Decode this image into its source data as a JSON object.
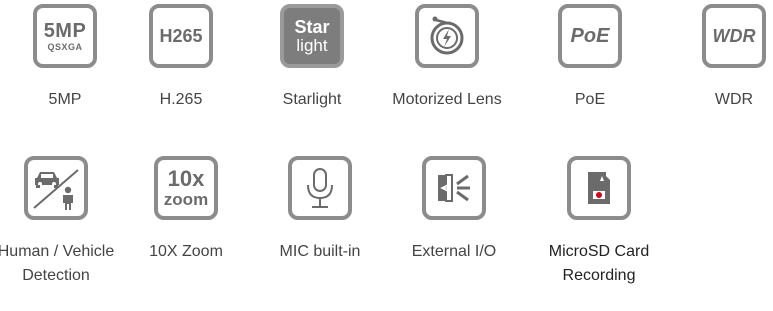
{
  "features": [
    {
      "id": "5mp",
      "label": "5MP",
      "icon": "5mp-qsxga-icon",
      "icon_text": "5MP",
      "icon_subtext": "QSXGA"
    },
    {
      "id": "h265",
      "label": "H.265",
      "icon": "h265-icon",
      "icon_text": "H265"
    },
    {
      "id": "starlight",
      "label": "Starlight",
      "icon": "starlight-icon",
      "icon_text": "Star",
      "icon_subtext": "light"
    },
    {
      "id": "motorized",
      "label": "Motorized Lens",
      "icon": "motorized-lens-icon"
    },
    {
      "id": "poe",
      "label": "PoE",
      "icon": "poe-icon",
      "icon_text": "PoE"
    },
    {
      "id": "wdr",
      "label": "WDR",
      "icon": "wdr-icon",
      "icon_text": "WDR"
    },
    {
      "id": "human-vehicle",
      "label": "Human / Vehicle Detection",
      "icon": "human-vehicle-detection-icon"
    },
    {
      "id": "zoom",
      "label": "10X Zoom",
      "icon": "zoom-10x-icon",
      "icon_text": "10x",
      "icon_subtext": "zoom"
    },
    {
      "id": "mic",
      "label": "MIC built-in",
      "icon": "microphone-icon"
    },
    {
      "id": "io",
      "label": "External I/O",
      "icon": "external-io-icon"
    },
    {
      "id": "microsd",
      "label": "MicroSD Card Recording",
      "icon": "microsd-card-icon"
    }
  ],
  "colors": {
    "icon_border": "#8c8c8c",
    "icon_glyph": "#6b6b6b",
    "starlight_fill": "#7d7d7d",
    "label_text": "#444444",
    "sd_red": "#d0021b"
  }
}
